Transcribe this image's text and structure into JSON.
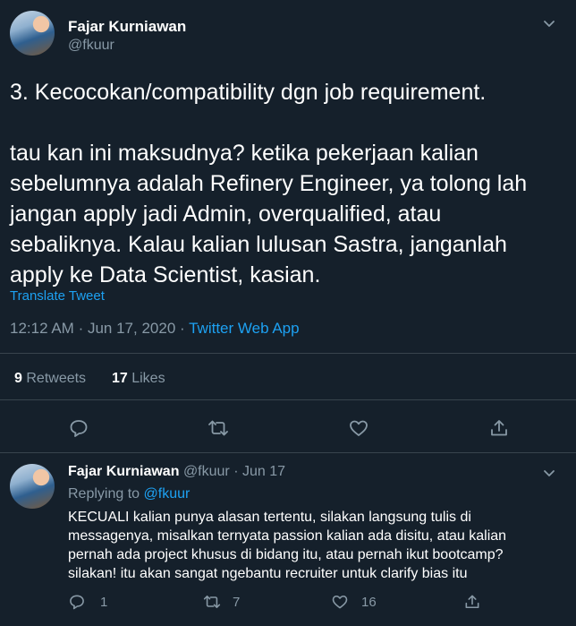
{
  "main_tweet": {
    "author_name": "Fajar Kurniawan",
    "author_handle": "@fkuur",
    "line1": "3. Kecocokan/compatibility dgn job requirement.",
    "body_lines": [
      "tau kan ini maksudnya? ketika pekerjaan kalian",
      "sebelumnya adalah Refinery Engineer, ya tolong lah",
      "jangan apply jadi Admin, overqualified, atau",
      "sebaliknya. Kalau kalian lulusan Sastra, janganlah",
      "apply ke Data Scientist, kasian."
    ],
    "translate_label": "Translate Tweet",
    "time": "12:12 AM",
    "date": "Jun 17, 2020",
    "separator": "·",
    "source": "Twitter Web App",
    "retweets_count": "9",
    "retweets_label": "Retweets",
    "likes_count": "17",
    "likes_label": "Likes",
    "actions": [
      "reply-icon",
      "retweet-icon",
      "like-icon",
      "share-icon"
    ]
  },
  "reply_tweet": {
    "author_name": "Fajar Kurniawan",
    "author_handle": "@fkuur",
    "separator": "·",
    "date": "Jun 17",
    "replying_prefix": "Replying to",
    "replying_handle": "@fkuur",
    "text_lines": [
      "KECUALI kalian punya alasan tertentu, silakan langsung tulis di",
      "messagenya, misalkan ternyata passion kalian ada disitu, atau kalian",
      "pernah ada project khusus di bidang itu, atau pernah ikut bootcamp?",
      "silakan! itu akan sangat ngebantu recruiter untuk clarify bias itu"
    ],
    "reply_count": "1",
    "retweet_count": "7",
    "like_count": "16"
  },
  "colors": {
    "background": "#15202b",
    "accent": "#1da1f2",
    "muted": "#8899a6",
    "divider": "#38444d"
  }
}
